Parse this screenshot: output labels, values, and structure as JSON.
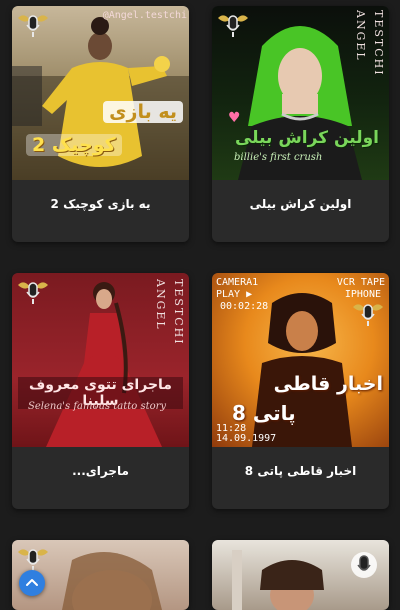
{
  "cards": [
    {
      "title": "یه بازی کوچیک 2",
      "watermark": "@Angel.testchi",
      "overlay_line1": "یه بازی",
      "overlay_line2": "کوچیک 2",
      "colors": {
        "bg_top": "#b8a98a",
        "bg_bottom": "#6d5c3a",
        "dress": "#e8c230",
        "overlay_text": "#ffe14d"
      }
    },
    {
      "title": "اولین کراش بیلی",
      "vertical_left": "ANGEL",
      "vertical_right": "TESTCHI",
      "overlay_line1": "اولین کراش بیلی",
      "overlay_line2": "billie's first crush",
      "colors": {
        "bg": "#0e1a0e",
        "hair": "#49c526",
        "overlay_text": "#7ad65b"
      }
    },
    {
      "title": "ماجرای...",
      "vertical_left": "ANGEL",
      "vertical_right": "TESTCHI",
      "overlay_line1": "ماجرای تتوی معروف سلینا",
      "overlay_line2": "Selena's famous tatto story",
      "colors": {
        "bg": "#8e1f26",
        "dress": "#b82028",
        "overlay_text": "#ffe6e6"
      }
    },
    {
      "title": "اخبار قاطی پاتی 8",
      "camera_label": "CAMERA1",
      "play_label": "PLAY ▶",
      "timecode": "00:02:28",
      "vcr_label": "VCR TAPE",
      "phone_label": "IPHONE",
      "time_bottom": "11:28",
      "date_bottom": "14.09.1997",
      "overlay_line1": "اخبار قاطی",
      "overlay_line2": "پاتی 8",
      "colors": {
        "bg": "#e98a1d",
        "overlay_text": "#ffffff"
      }
    },
    {
      "title": ""
    },
    {
      "title": ""
    }
  ],
  "scroll_top_icon": "chevron-up-icon"
}
